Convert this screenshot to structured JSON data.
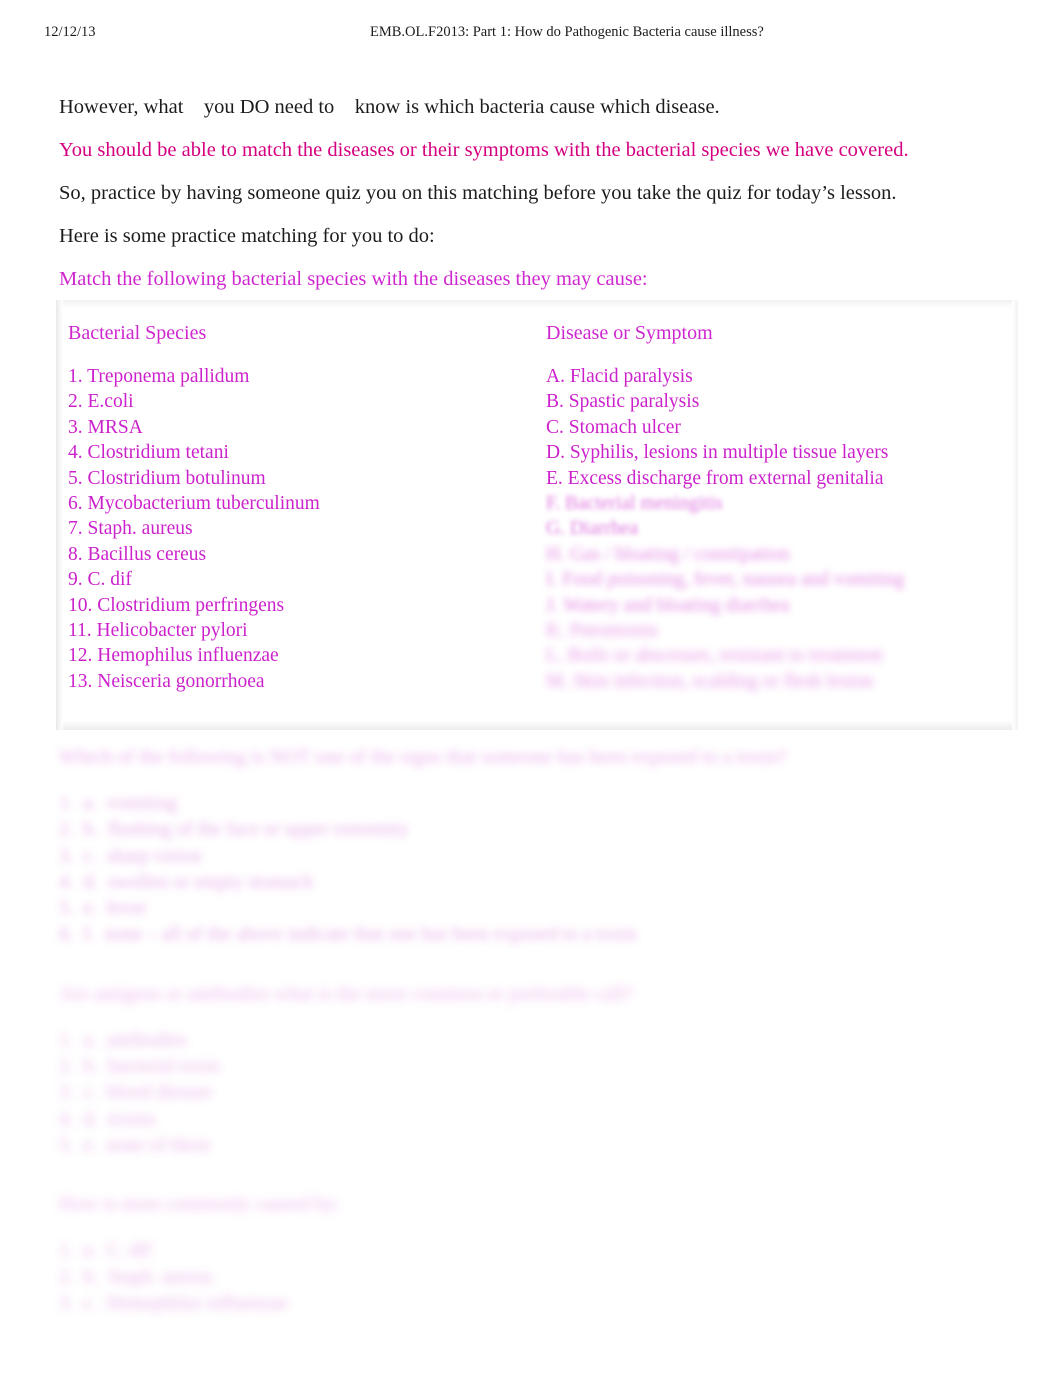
{
  "header": {
    "date": "12/12/13",
    "title": "EMB.OL.F2013: Part 1: How do Pathogenic Bacteria cause illness?"
  },
  "intro": {
    "p1": "However, what    you DO need to    know is which bacteria cause which disease.",
    "p2": "You should be able to match the diseases or their symptoms with the bacterial species we have covered.",
    "p3": "So, practice by having someone quiz you on this matching before you take the quiz for today’s lesson.",
    "p4": "Here is some practice matching for you to do:",
    "p5": "Match the following bacterial species with the diseases they may cause:"
  },
  "matching": {
    "species_heading": "Bacterial Species",
    "disease_heading": "Disease or Symptom",
    "species": [
      "1. Treponema pallidum",
      "2. E.coli",
      "3. MRSA",
      "4. Clostridium tetani",
      "5. Clostridium botulinum",
      "6. Mycobacterium tuberculinum",
      "7. Staph. aureus",
      "8. Bacillus cereus",
      "9. C. dif",
      "10. Clostridium perfringens",
      "11. Helicobacter pylori",
      "12. Hemophilus influenzae",
      "13. Neisceria gonorrhoea"
    ],
    "diseases": [
      "A. Flacid paralysis",
      "B. Spastic paralysis",
      "C. Stomach ulcer",
      "D. Syphilis, lesions in multiple tissue layers",
      "E. Excess discharge from external genitalia",
      "F. Bacterial meningitis",
      "G. Diarrhea",
      "H. Gas / bloating / constipation",
      "I. Food poisoning, fever, nausea and vomiting",
      "J. Watery and bloating diarrhea",
      "K. Pneumonia",
      "L. Boils or abscesses, resistant to treatment",
      "M. Skin infection, scalding or flesh lesion"
    ]
  },
  "lower": {
    "section1": {
      "prompt": "Which of the following is NOT one of the signs that someone has been exposed to a toxin?",
      "answers": [
        "1.  a.  vomiting",
        "2.  b.  flushing of the face or upper extremity",
        "3.  c.  sharp vision",
        "4.  d.  swollen or empty stomach",
        "5.  e.  fever",
        "6.  f.  none – all of the above indicate that one has been exposed to a toxin"
      ]
    },
    "section2": {
      "prompt": "Are antigens or antibodies what is the more common or preferable call?",
      "answers": [
        "1.  a.  antibodies",
        "2.  b.  bacterial toxin",
        "3.  c.  blood disease",
        "4.  d.  toxins",
        "5.  e.  none of these"
      ]
    },
    "section3": {
      "prompt": "How is most commonly caused by:",
      "answers": [
        "1.  a.  C. dif",
        "2.  b.  Staph. aureus",
        "3.  c.  Hemophilus influenzae"
      ]
    }
  },
  "colors": {
    "accent_magenta": "#d4007f",
    "accent_purple": "#cc22cc",
    "body_text": "#1c1c1c",
    "page_background": "#ffffff"
  }
}
